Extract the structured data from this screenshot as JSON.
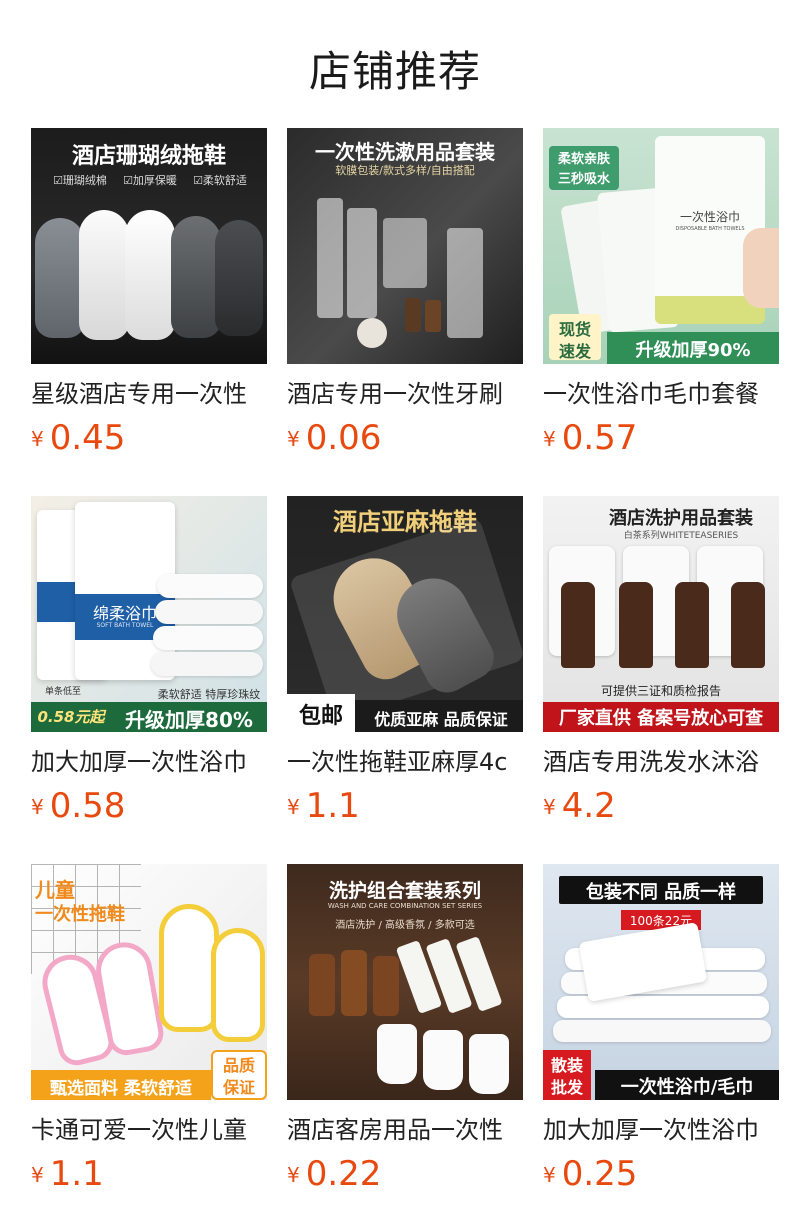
{
  "header": {
    "title": "店铺推荐"
  },
  "currency": "¥",
  "products": [
    {
      "name": "星级酒店专用一次性",
      "price": "0.45",
      "image_text": {
        "headline": "酒店珊瑚绒拖鞋",
        "features": [
          "☑珊瑚绒棉",
          "☑加厚保暖",
          "☑柔软舒适"
        ]
      }
    },
    {
      "name": "酒店专用一次性牙刷",
      "price": "0.06",
      "image_text": {
        "headline": "一次性洗漱用品套装",
        "subline": "软膜包装/款式多样/自由搭配"
      }
    },
    {
      "name": "一次性浴巾毛巾套餐",
      "price": "0.57",
      "image_text": {
        "tag1": "柔软亲肤",
        "tag2": "三秒吸水",
        "package_label": "一次性浴巾",
        "package_sub": "DISPOSABLE BATH TOWELS",
        "badge1": "现货",
        "badge2": "速发",
        "bottom": "升级加厚90%"
      }
    },
    {
      "name": "加大加厚一次性浴巾",
      "price": "0.58",
      "image_text": {
        "package_label": "绵柔浴巾",
        "package_sub": "SOFT BATH TOWEL",
        "note": "柔软舒适 特厚珍珠纹",
        "low_price": "单条低至",
        "low_price_value": "0.58元起",
        "bottom": "升级加厚80%"
      }
    },
    {
      "name": "一次性拖鞋亚麻厚4c",
      "price": "1.1",
      "image_text": {
        "headline": "酒店亚麻拖鞋",
        "badge": "包邮",
        "bottom": "优质亚麻 品质保证"
      }
    },
    {
      "name": "酒店专用洗发水沐浴",
      "price": "4.2",
      "image_text": {
        "headline": "酒店洗护用品套装",
        "subline": "白茶系列WHITETEASERIES",
        "note": "可提供三证和质检报告",
        "bottom": "厂家直供 备案号放心可查"
      }
    },
    {
      "name": "卡通可爱一次性儿童",
      "price": "1.1",
      "image_text": {
        "headline1": "儿童",
        "headline2": "一次性拖鞋",
        "bottom": "甄选面料 柔软舒适",
        "badge1": "品质",
        "badge2": "保证"
      }
    },
    {
      "name": "酒店客房用品一次性",
      "price": "0.22",
      "image_text": {
        "headline": "洗护组合套装系列",
        "subline": "WASH AND CARE COMBINATION SET SERIES",
        "subline2": "酒店洗护 / 高级香氛 / 多款可选"
      }
    },
    {
      "name": "加大加厚一次性浴巾",
      "price": "0.25",
      "image_text": {
        "headline": "包装不同 品质一样",
        "price_tag": "100条22元",
        "badge1": "散装",
        "badge2": "批发",
        "bottom": "一次性浴巾/毛巾"
      }
    }
  ]
}
